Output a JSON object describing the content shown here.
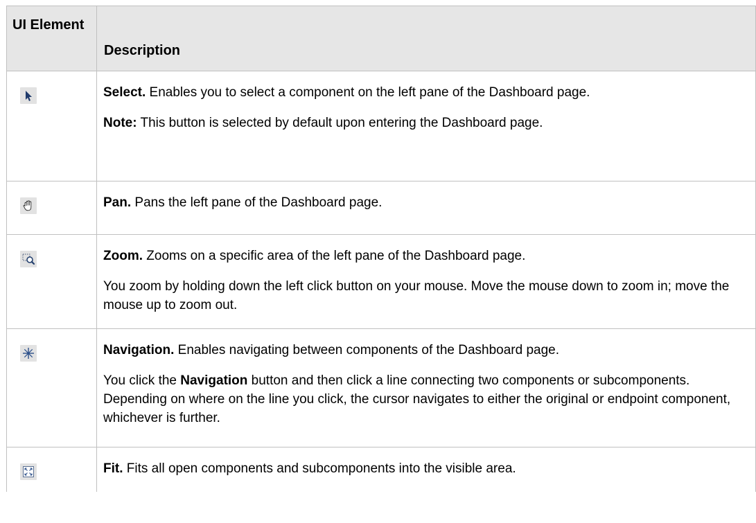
{
  "table": {
    "header": {
      "ui_element": "UI Element",
      "description": "Description"
    },
    "rows": [
      {
        "icon": "select-arrow-icon",
        "title": "Select.",
        "text": " Enables you to select a component on the left pane of the Dashboard page.",
        "note_label": "Note:",
        "note_text": " This button is selected by default upon entering the Dashboard page."
      },
      {
        "icon": "pan-hand-icon",
        "title": "Pan.",
        "text": " Pans the left pane of the Dashboard page."
      },
      {
        "icon": "zoom-icon",
        "title": "Zoom.",
        "text": " Zooms on a specific area of the left pane of the Dashboard page.",
        "extra": "You zoom by holding down the left click button on your mouse. Move the mouse down to zoom in; move the mouse up to zoom out."
      },
      {
        "icon": "navigation-icon",
        "title": "Navigation.",
        "text": " Enables navigating between components of the Dashboard page.",
        "extra_pre": "You click the ",
        "extra_bold": "Navigation",
        "extra_post": " button and then click a line connecting two components or subcomponents. Depending on where on the line you click, the cursor navigates to either the original or endpoint component, whichever is further."
      },
      {
        "icon": "fit-icon",
        "title": "Fit.",
        "text": " Fits all open components and subcomponents into the visible area."
      }
    ]
  }
}
